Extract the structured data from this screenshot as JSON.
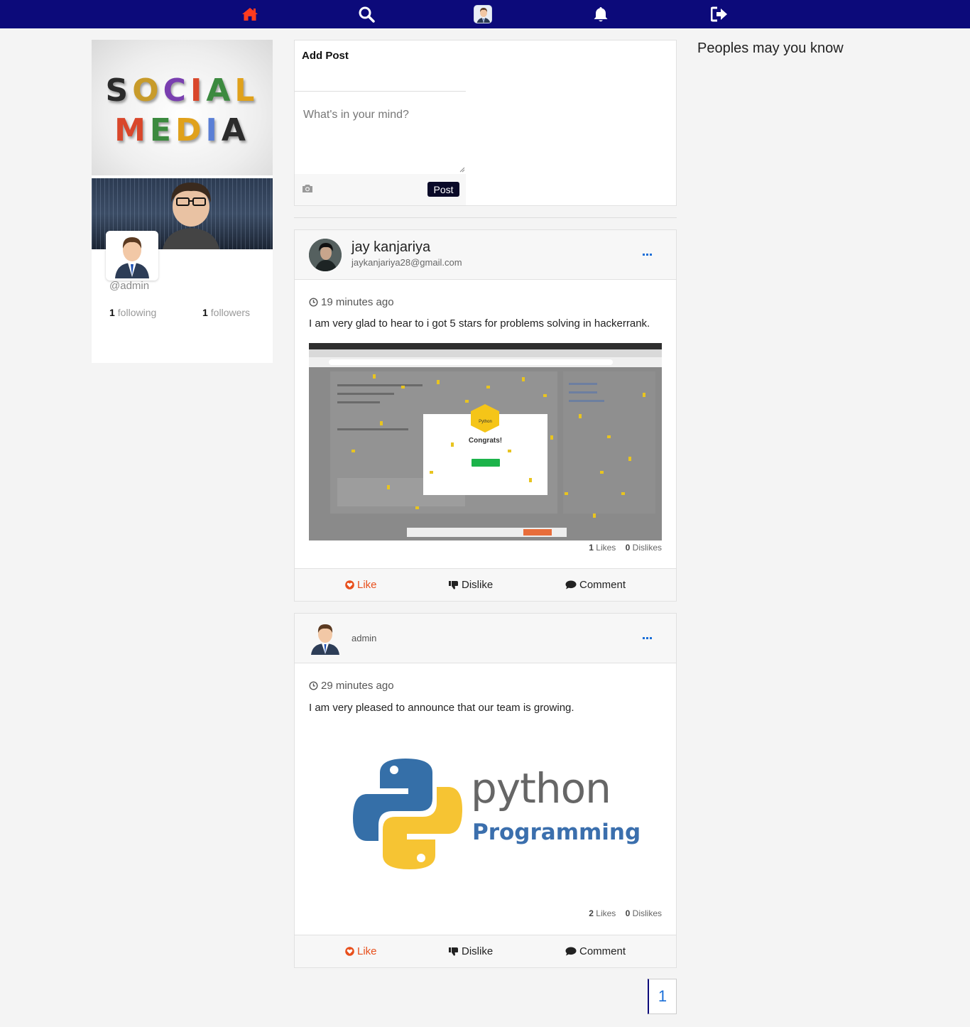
{
  "nav": {
    "items": [
      "home-icon",
      "search-icon",
      "profile-avatar",
      "bell-icon",
      "logout-icon"
    ],
    "active_color": "#ff3b1f",
    "bg_color": "#0c0a7a"
  },
  "profile": {
    "banner_word_1": "SOCIAL",
    "banner_word_2": "MEDIA",
    "handle": "@admin",
    "following_count": "1",
    "following_label": "following",
    "followers_count": "1",
    "followers_label": "followers"
  },
  "composer": {
    "title": "Add Post",
    "placeholder": "What's in your mind?",
    "post_label": "Post"
  },
  "posts": [
    {
      "author": "jay kanjariya",
      "email": "jaykanjariya28@gmail.com",
      "time": "19 minutes ago",
      "text": "I am very glad to hear to i got 5 stars for problems solving in hackerrank.",
      "image_title": "Congrats!",
      "image_badge": "Python",
      "likes": "1",
      "likes_label": "Likes",
      "dislikes": "0",
      "dislikes_label": "Dislikes"
    },
    {
      "author": "admin",
      "time": "29 minutes ago",
      "text": "I am very pleased to announce that our team is growing.",
      "image_word": "python",
      "image_sub": "Programming",
      "likes": "2",
      "likes_label": "Likes",
      "dislikes": "0",
      "dislikes_label": "Dislikes"
    }
  ],
  "actions": {
    "like": "Like",
    "dislike": "Dislike",
    "comment": "Comment"
  },
  "sidebar": {
    "title": "Peoples may you know"
  },
  "pagination": {
    "current": "1"
  }
}
